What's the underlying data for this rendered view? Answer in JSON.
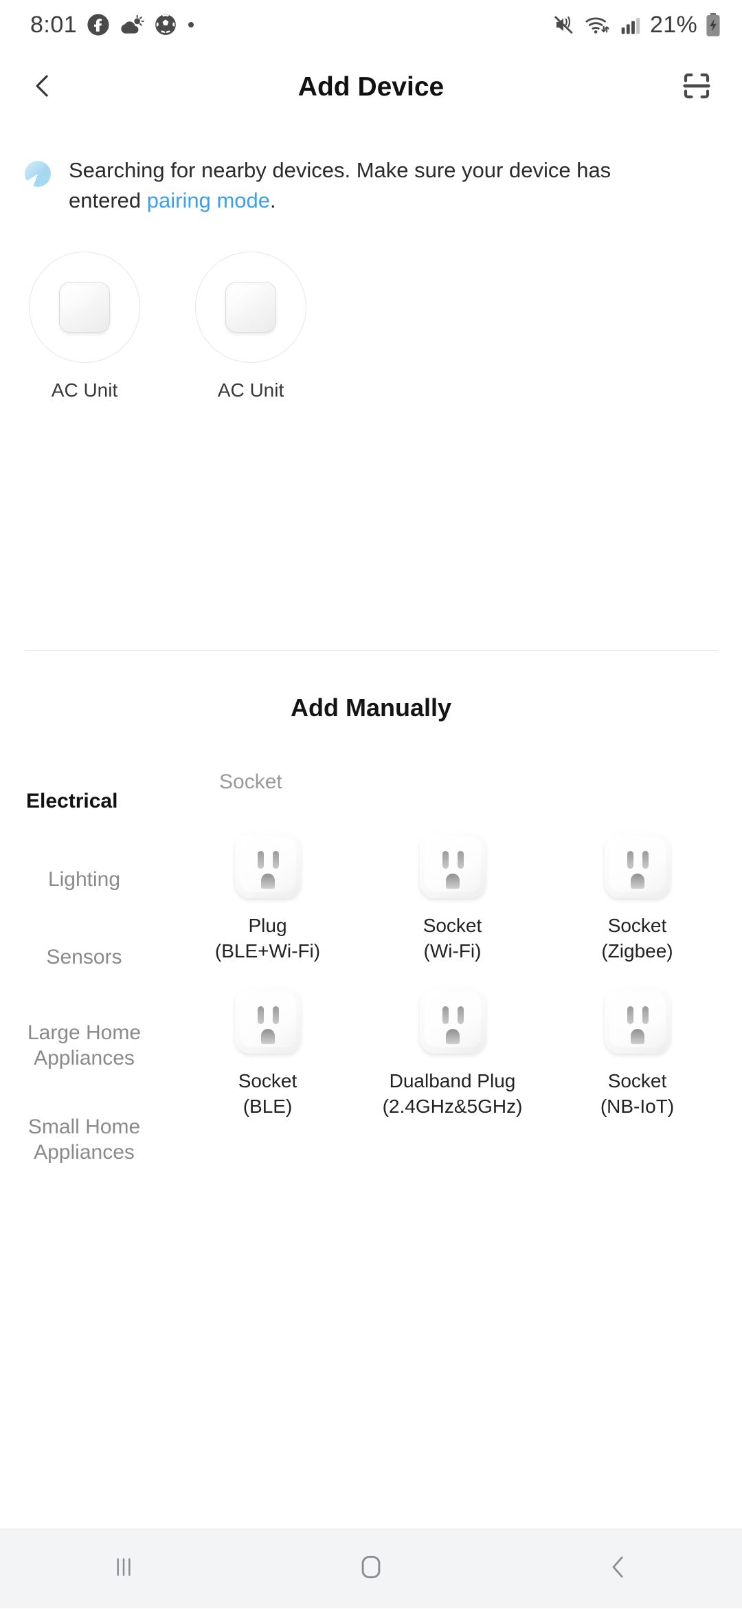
{
  "statusbar": {
    "time": "8:01",
    "battery_percent": "21%",
    "left_icons": [
      "facebook-icon",
      "weather-icon",
      "soccer-ball-icon",
      "dot-icon"
    ],
    "right_icons": [
      "mute-vibrate-icon",
      "wifi-icon",
      "cellular-signal-icon",
      "battery-charging-icon"
    ]
  },
  "header": {
    "title": "Add Device",
    "back_icon": "chevron-left-icon",
    "scan_icon": "scan-qr-icon"
  },
  "notice": {
    "text_before": "Searching for nearby devices. Make sure your device has entered ",
    "link": "pairing mode",
    "text_after": "."
  },
  "found_devices": [
    {
      "label": "AC Unit"
    },
    {
      "label": "AC Unit"
    }
  ],
  "manual": {
    "title": "Add Manually",
    "panel_header": "Socket",
    "categories": [
      {
        "label": "Electrical",
        "selected": true
      },
      {
        "label": "Lighting",
        "selected": false
      },
      {
        "label": "Sensors",
        "selected": false
      },
      {
        "label": "Large Home Appliances",
        "selected": false
      },
      {
        "label": "Small Home Appliances",
        "selected": false
      }
    ],
    "devices": [
      {
        "name": "Plug",
        "protocol": "(BLE+Wi-Fi)"
      },
      {
        "name": "Socket",
        "protocol": "(Wi-Fi)"
      },
      {
        "name": "Socket",
        "protocol": "(Zigbee)"
      },
      {
        "name": "Socket",
        "protocol": "(BLE)"
      },
      {
        "name": "Dualband Plug",
        "protocol": "(2.4GHz&5GHz)"
      },
      {
        "name": "Socket",
        "protocol": "(NB-IoT)"
      }
    ]
  },
  "navbar": {
    "recents_icon": "recents-icon",
    "home_icon": "home-icon",
    "back_icon": "nav-back-icon"
  },
  "colors": {
    "link": "#3ca0ee",
    "spinner": "#a7d8f2",
    "text_primary": "#222222",
    "text_muted": "#8a8a8a",
    "navbar_bg": "#f3f4f6"
  }
}
